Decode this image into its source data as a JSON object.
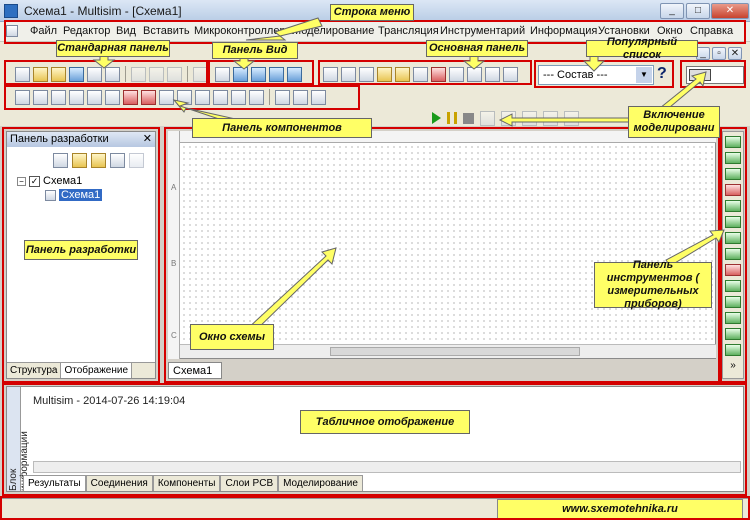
{
  "window": {
    "title": "Схема1 - Multisim - [Схема1]",
    "controls": [
      "_",
      "□",
      "✕"
    ]
  },
  "menu": [
    "Файл",
    "Редактор",
    "Вид",
    "Вставить",
    "Микроконтроллеры",
    "Моделирование",
    "Трансляция",
    "Инструментарий",
    "Информация",
    "Установки",
    "Окно",
    "Справка"
  ],
  "toolbar": {
    "component_list_value": "--- Состав ---",
    "help_glyph": "?"
  },
  "design_panel": {
    "title": "Панель разработки",
    "tree_root": "Схема1",
    "tree_child": "Схема1",
    "tabs": [
      "Структура",
      "Отображение"
    ]
  },
  "schematic": {
    "tab_label": "Схема1",
    "ruler_rows": [
      "A",
      "B",
      "C"
    ]
  },
  "spreadsheet": {
    "side_label": "Блок информации",
    "log_line": "Multisim  -  2014-07-26 14:19:04",
    "tabs": [
      "Результаты",
      "Соединения",
      "Компоненты",
      "Слои PCB",
      "Моделирование"
    ]
  },
  "callouts": {
    "menu": "Строка меню",
    "standard": "Стандарная панель",
    "view": "Панель Вид",
    "main": "Основная панель",
    "popular": "Популярный список",
    "components": "Панель компонентов",
    "simulation": "Включение моделировани",
    "design": "Панель разработки",
    "circuit": "Окно схемы",
    "instruments": "Панель инструментов ( измерительных приборов)",
    "spreadsheet": "Табличное отображение"
  },
  "footer": {
    "site": "www.sxemotehnika.ru"
  },
  "colors": {
    "highlight": "#d40000",
    "callout_bg": "#ffff66"
  }
}
